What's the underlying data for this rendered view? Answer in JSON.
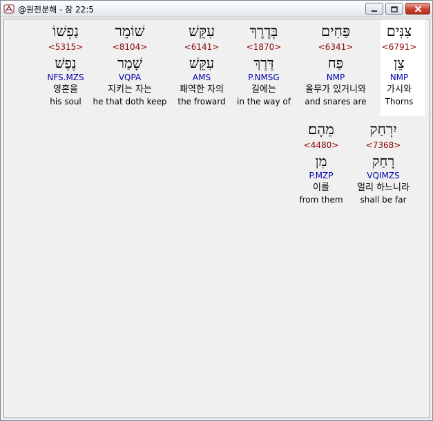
{
  "window": {
    "title": "@원전분해 - 잠 22:5"
  },
  "icons": {
    "app": "hebrew-book-icon",
    "minimize": "minimize-icon",
    "maximize": "maximize-icon",
    "close": "close-icon"
  },
  "colors": {
    "strong_number": "#8b0000",
    "morphology": "#0000b0",
    "selected_background": "#ffffff"
  },
  "rows": [
    [
      {
        "hebrew": "צִנִּים",
        "strong": "<6791>",
        "lexeme": "צֵן",
        "morph": "NMP",
        "korean": "가시와",
        "english": "Thorns"
      },
      {
        "hebrew": "פַּחִים",
        "strong": "<6341>",
        "lexeme": "פַּח",
        "morph": "NMP",
        "korean": "올무가 있거니와",
        "english": "and snares are"
      },
      {
        "hebrew": "בְּדֶרֶךְ",
        "strong": "<1870>",
        "lexeme": "דֶּרֶךְ",
        "morph": "P.NMSG",
        "korean": "길에는",
        "english": "in the way of"
      },
      {
        "hebrew": "עִקֵּשׁ",
        "strong": "<6141>",
        "lexeme": "עִקֵּשׁ",
        "morph": "AMS",
        "korean": "패역한 자의",
        "english": "the froward"
      },
      {
        "hebrew": "שׁוֹמֵר",
        "strong": "<8104>",
        "lexeme": "שָׁמַר",
        "morph": "VQPA",
        "korean": "지키는 자는",
        "english": "he that doth keep"
      },
      {
        "hebrew": "נַפְשׁוֹ",
        "strong": "<5315>",
        "lexeme": "נֶפֶשׁ",
        "morph": "NFS.MZS",
        "korean": "영혼을",
        "english": "his soul"
      }
    ],
    [
      {
        "hebrew": "יִרְחַק",
        "strong": "<7368>",
        "lexeme": "רָחַק",
        "morph": "VQIMZS",
        "korean": "멀리 하느니라",
        "english": "shall be far"
      },
      {
        "hebrew": "מֵהֶם׃",
        "strong": "<4480>",
        "lexeme": "מִן",
        "morph": "P.MZP",
        "korean": "이를",
        "english": "from them"
      }
    ]
  ]
}
